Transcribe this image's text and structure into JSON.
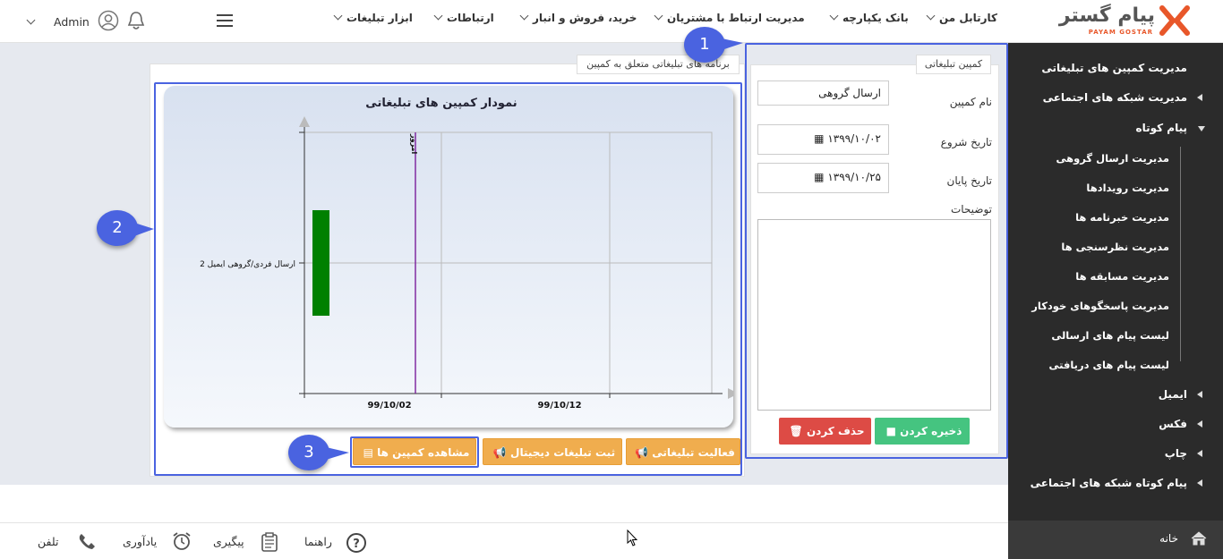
{
  "topbar": {
    "logo": {
      "text": "پیام گستر",
      "subtext": "PAYAM GOSTAR"
    },
    "menu": [
      "کارتابل من",
      "بانک یکپارچه",
      "مدیریت ارتباط با مشتریان",
      "خرید، فروش و انبار",
      "ارتباطات",
      "ابزار تبلیغات"
    ],
    "user": "Admin"
  },
  "sidebar": {
    "items": [
      "مدیریت کمپین های تبلیغاتی",
      "مدیریت شبکه های اجتماعی",
      "پیام کوتاه"
    ],
    "subitems": [
      "مدیریت ارسال گروهی",
      "مدیریت رویدادها",
      "مدیریت خبرنامه ها",
      "مدیریت نظرسنجی ها",
      "مدیریت مسابقه ها",
      "مدیریت پاسخگوهای خودکار",
      "لیست پیام های ارسالی",
      "لیست پیام های دریافتی"
    ],
    "bottom_items": [
      "ایمیل",
      "فکس",
      "چاپ",
      "پیام کوتاه شبکه های اجتماعی"
    ],
    "home": "خانه"
  },
  "form": {
    "tab": "کمپین تبلیغاتی",
    "name_label": "نام کمپین",
    "name_value": "ارسال گروهی",
    "start_label": "تاریخ شروع",
    "start_value": "۱۳۹۹/۱۰/۰۲",
    "end_label": "تاریخ پایان",
    "end_value": "۱۳۹۹/۱۰/۲۵",
    "desc_label": "توضیحات",
    "save": "ذخیره کردن",
    "delete": "حذف کردن"
  },
  "program": {
    "tab": "برنامه های تبلیغاتی متعلق به کمپین",
    "buttons": [
      "فعالیت تبلیغاتی",
      "ثبت تبلیغات دیجیتال",
      "مشاهده کمپین ها"
    ]
  },
  "callouts": [
    "1",
    "2",
    "3"
  ],
  "chart_data": {
    "type": "bar",
    "title": "نمودار کمپین های تبلیغاتی",
    "categories": [
      "ارسال فردی/گروهی ایمیل 2"
    ],
    "x_ticks": [
      "99/10/02",
      "99/10/12"
    ],
    "today_label": "امروز",
    "bar_color": "#008000",
    "today_color": "#7a1f9c"
  },
  "footer": {
    "items": [
      "تلفن",
      "یادآوری",
      "پیگیری",
      "راهنما"
    ]
  },
  "colors": {
    "accent": "#4a63e0",
    "orange": "#f0ad4e",
    "save": "#45c480",
    "delete": "#dd4b45",
    "sidebar": "#2b2b2b"
  }
}
